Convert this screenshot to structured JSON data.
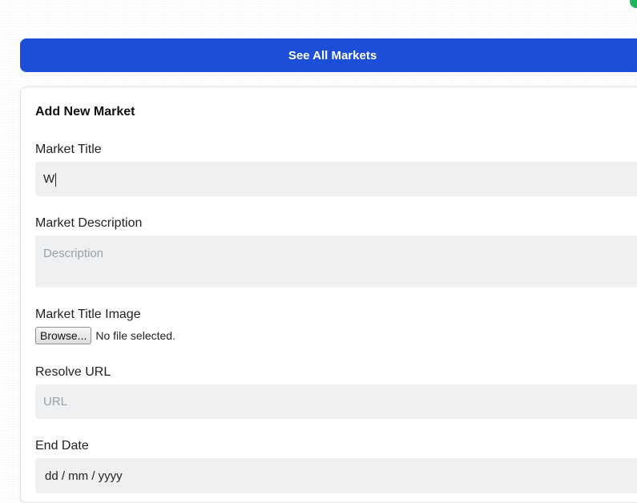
{
  "header": {
    "see_all_label": "See All Markets"
  },
  "form": {
    "heading": "Add New Market",
    "title_label": "Market Title",
    "title_value": "W",
    "description_label": "Market Description",
    "description_placeholder": "Description",
    "image_label": "Market Title Image",
    "browse_label": "Browse...",
    "file_status": "No file selected.",
    "resolve_label": "Resolve URL",
    "resolve_placeholder": "URL",
    "end_date_label": "End Date",
    "end_date_placeholder": "dd / mm / yyyy"
  },
  "colors": {
    "primary": "#1d4ed8",
    "status_dot": "#22b35e",
    "field_bg": "#eff0f2"
  }
}
